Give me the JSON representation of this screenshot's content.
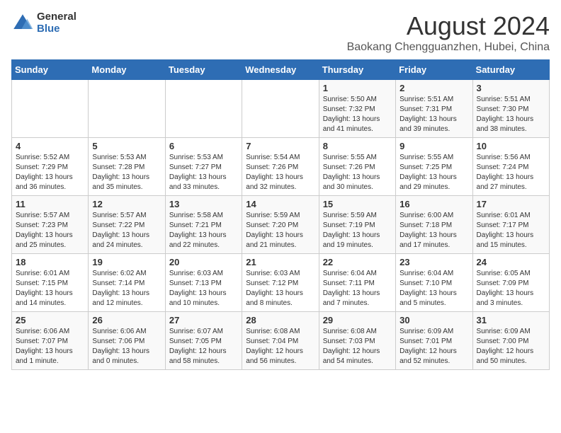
{
  "logo": {
    "general": "General",
    "blue": "Blue"
  },
  "title": "August 2024",
  "subtitle": "Baokang Chengguanzhen, Hubei, China",
  "days_of_week": [
    "Sunday",
    "Monday",
    "Tuesday",
    "Wednesday",
    "Thursday",
    "Friday",
    "Saturday"
  ],
  "weeks": [
    [
      {
        "day": "",
        "info": ""
      },
      {
        "day": "",
        "info": ""
      },
      {
        "day": "",
        "info": ""
      },
      {
        "day": "",
        "info": ""
      },
      {
        "day": "1",
        "info": "Sunrise: 5:50 AM\nSunset: 7:32 PM\nDaylight: 13 hours\nand 41 minutes."
      },
      {
        "day": "2",
        "info": "Sunrise: 5:51 AM\nSunset: 7:31 PM\nDaylight: 13 hours\nand 39 minutes."
      },
      {
        "day": "3",
        "info": "Sunrise: 5:51 AM\nSunset: 7:30 PM\nDaylight: 13 hours\nand 38 minutes."
      }
    ],
    [
      {
        "day": "4",
        "info": "Sunrise: 5:52 AM\nSunset: 7:29 PM\nDaylight: 13 hours\nand 36 minutes."
      },
      {
        "day": "5",
        "info": "Sunrise: 5:53 AM\nSunset: 7:28 PM\nDaylight: 13 hours\nand 35 minutes."
      },
      {
        "day": "6",
        "info": "Sunrise: 5:53 AM\nSunset: 7:27 PM\nDaylight: 13 hours\nand 33 minutes."
      },
      {
        "day": "7",
        "info": "Sunrise: 5:54 AM\nSunset: 7:26 PM\nDaylight: 13 hours\nand 32 minutes."
      },
      {
        "day": "8",
        "info": "Sunrise: 5:55 AM\nSunset: 7:26 PM\nDaylight: 13 hours\nand 30 minutes."
      },
      {
        "day": "9",
        "info": "Sunrise: 5:55 AM\nSunset: 7:25 PM\nDaylight: 13 hours\nand 29 minutes."
      },
      {
        "day": "10",
        "info": "Sunrise: 5:56 AM\nSunset: 7:24 PM\nDaylight: 13 hours\nand 27 minutes."
      }
    ],
    [
      {
        "day": "11",
        "info": "Sunrise: 5:57 AM\nSunset: 7:23 PM\nDaylight: 13 hours\nand 25 minutes."
      },
      {
        "day": "12",
        "info": "Sunrise: 5:57 AM\nSunset: 7:22 PM\nDaylight: 13 hours\nand 24 minutes."
      },
      {
        "day": "13",
        "info": "Sunrise: 5:58 AM\nSunset: 7:21 PM\nDaylight: 13 hours\nand 22 minutes."
      },
      {
        "day": "14",
        "info": "Sunrise: 5:59 AM\nSunset: 7:20 PM\nDaylight: 13 hours\nand 21 minutes."
      },
      {
        "day": "15",
        "info": "Sunrise: 5:59 AM\nSunset: 7:19 PM\nDaylight: 13 hours\nand 19 minutes."
      },
      {
        "day": "16",
        "info": "Sunrise: 6:00 AM\nSunset: 7:18 PM\nDaylight: 13 hours\nand 17 minutes."
      },
      {
        "day": "17",
        "info": "Sunrise: 6:01 AM\nSunset: 7:17 PM\nDaylight: 13 hours\nand 15 minutes."
      }
    ],
    [
      {
        "day": "18",
        "info": "Sunrise: 6:01 AM\nSunset: 7:15 PM\nDaylight: 13 hours\nand 14 minutes."
      },
      {
        "day": "19",
        "info": "Sunrise: 6:02 AM\nSunset: 7:14 PM\nDaylight: 13 hours\nand 12 minutes."
      },
      {
        "day": "20",
        "info": "Sunrise: 6:03 AM\nSunset: 7:13 PM\nDaylight: 13 hours\nand 10 minutes."
      },
      {
        "day": "21",
        "info": "Sunrise: 6:03 AM\nSunset: 7:12 PM\nDaylight: 13 hours\nand 8 minutes."
      },
      {
        "day": "22",
        "info": "Sunrise: 6:04 AM\nSunset: 7:11 PM\nDaylight: 13 hours\nand 7 minutes."
      },
      {
        "day": "23",
        "info": "Sunrise: 6:04 AM\nSunset: 7:10 PM\nDaylight: 13 hours\nand 5 minutes."
      },
      {
        "day": "24",
        "info": "Sunrise: 6:05 AM\nSunset: 7:09 PM\nDaylight: 13 hours\nand 3 minutes."
      }
    ],
    [
      {
        "day": "25",
        "info": "Sunrise: 6:06 AM\nSunset: 7:07 PM\nDaylight: 13 hours\nand 1 minute."
      },
      {
        "day": "26",
        "info": "Sunrise: 6:06 AM\nSunset: 7:06 PM\nDaylight: 13 hours\nand 0 minutes."
      },
      {
        "day": "27",
        "info": "Sunrise: 6:07 AM\nSunset: 7:05 PM\nDaylight: 12 hours\nand 58 minutes."
      },
      {
        "day": "28",
        "info": "Sunrise: 6:08 AM\nSunset: 7:04 PM\nDaylight: 12 hours\nand 56 minutes."
      },
      {
        "day": "29",
        "info": "Sunrise: 6:08 AM\nSunset: 7:03 PM\nDaylight: 12 hours\nand 54 minutes."
      },
      {
        "day": "30",
        "info": "Sunrise: 6:09 AM\nSunset: 7:01 PM\nDaylight: 12 hours\nand 52 minutes."
      },
      {
        "day": "31",
        "info": "Sunrise: 6:09 AM\nSunset: 7:00 PM\nDaylight: 12 hours\nand 50 minutes."
      }
    ]
  ]
}
